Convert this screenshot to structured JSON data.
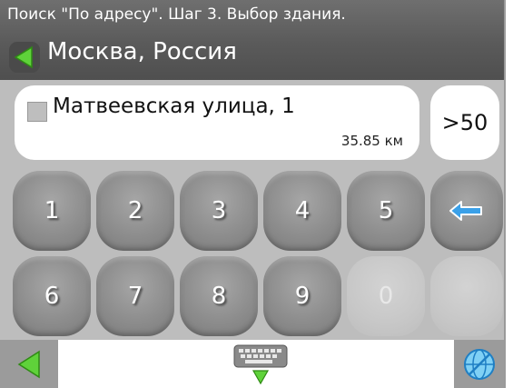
{
  "header": {
    "title": "Поиск \"По адресу\". Шаг 3. Выбор здания.",
    "city": "Москва, Россия"
  },
  "result": {
    "street": "Матвеевская улица, 1",
    "distance": "35.85 км"
  },
  "count": ">50",
  "keypad": {
    "row1": [
      "1",
      "2",
      "3",
      "4",
      "5"
    ],
    "row2": [
      "6",
      "7",
      "8",
      "9",
      "0"
    ]
  },
  "icons": {
    "back": "back-arrow-icon",
    "backspace": "backspace-arrow-icon",
    "keyboard": "keyboard-icon",
    "globe": "globe-icon"
  },
  "colors": {
    "header_bg": "#5f5f5f",
    "accent_green": "#5fd23a",
    "key_bg": "#8d8d8d",
    "backspace_blue": "#3aa0e8"
  }
}
